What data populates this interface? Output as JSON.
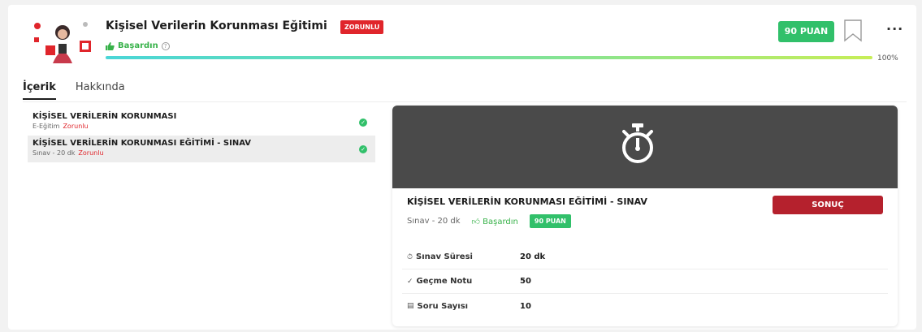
{
  "course": {
    "title": "Kişisel Verilerin Korunması Eğitimi",
    "required_badge": "ZORUNLU",
    "status": "Başardın",
    "progress_percent": 100,
    "progress_label": "100%",
    "points": "90 PUAN"
  },
  "tabs": [
    {
      "label": "İçerik",
      "active": true
    },
    {
      "label": "Hakkında",
      "active": false
    }
  ],
  "items": [
    {
      "title": "KİŞİSEL VERİLERİN KORUNMASI",
      "type": "E-Eğitim",
      "required": "Zorunlu",
      "completed": true
    },
    {
      "title": "KİŞİSEL VERİLERİN KORUNMASI EĞİTİMİ - SINAV",
      "type": "Sınav - 20 dk",
      "required": "Zorunlu",
      "completed": true
    }
  ],
  "detail": {
    "title": "KİŞİSEL VERİLERİN KORUNMASI EĞİTİMİ - SINAV",
    "result_button": "SONUÇ",
    "meta_type": "Sınav - 20 dk",
    "meta_status": "Başardın",
    "meta_points": "90 PUAN",
    "specs": [
      {
        "icon": "clock-icon",
        "label": "Sınav Süresi",
        "value": "20 dk"
      },
      {
        "icon": "check-icon",
        "label": "Geçme Notu",
        "value": "50"
      },
      {
        "icon": "list-icon",
        "label": "Soru Sayısı",
        "value": "10"
      }
    ]
  },
  "colors": {
    "accent_green": "#31c06a",
    "required_red": "#e0252b",
    "result_button": "#b5212d",
    "hero_bg": "#4a4a4a"
  }
}
